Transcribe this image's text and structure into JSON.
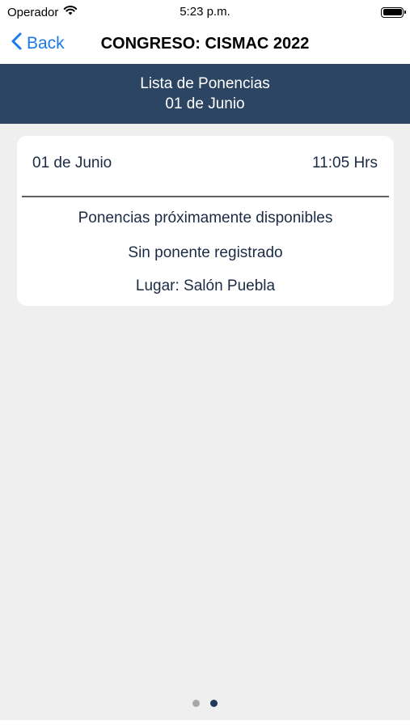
{
  "status_bar": {
    "carrier": "Operador",
    "time": "5:23 p.m.",
    "wifi_icon": "wifi-icon",
    "battery_icon": "battery-icon"
  },
  "nav": {
    "back_label": "Back",
    "title": "CONGRESO: CISMAC 2022"
  },
  "header": {
    "title": "Lista de Ponencias",
    "subtitle": "01 de Junio"
  },
  "card": {
    "date": "01 de Junio",
    "time": "11:05 Hrs",
    "line1": "Ponencias próximamente disponibles",
    "line2": "Sin ponente registrado",
    "line3": "Lugar: Salón Puebla"
  },
  "pagination": {
    "total_pages": 2,
    "current_page": 2
  },
  "colors": {
    "accent": "#1a7ae8",
    "header_bg": "#2c4562",
    "content_bg": "#efefef",
    "text": "#1b2b45"
  }
}
